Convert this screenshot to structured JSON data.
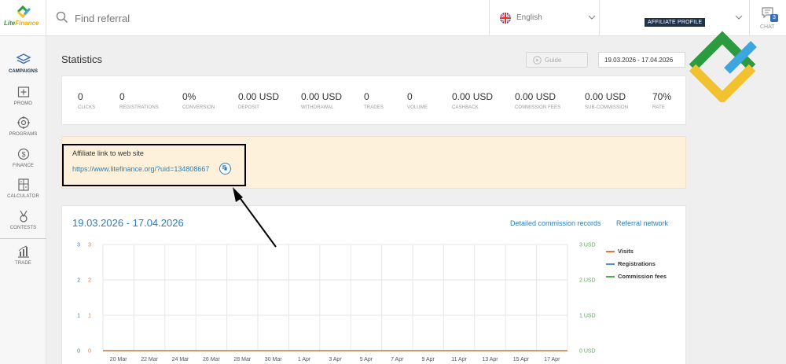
{
  "brand": {
    "name_part1": "Lite",
    "name_part2": "Finance"
  },
  "search": {
    "placeholder": "Find referral"
  },
  "language": {
    "label": "English",
    "flag_icon": "uk-flag-icon"
  },
  "profile": {
    "badge": "AFFILIATE PROFILE"
  },
  "chat": {
    "label": "CHAT",
    "count": "3"
  },
  "sidebar": {
    "items": [
      {
        "label": "CAMPAIGNS",
        "icon": "campaigns-icon",
        "active": true
      },
      {
        "label": "PROMO",
        "icon": "promo-icon"
      },
      {
        "label": "PROGRAMS",
        "icon": "programs-icon"
      },
      {
        "label": "FINANCE",
        "icon": "finance-icon"
      },
      {
        "label": "CALCULATOR",
        "icon": "calculator-icon"
      },
      {
        "label": "CONTESTS",
        "icon": "contests-icon"
      },
      {
        "label": "TRADE",
        "icon": "trade-icon"
      }
    ]
  },
  "page": {
    "title": "Statistics",
    "guide_label": "Guide",
    "date_range": "19.03.2026 - 17.04.2026"
  },
  "stats": [
    {
      "value": "0",
      "label": "CLICKS"
    },
    {
      "value": "0",
      "label": "REGISTRATIONS"
    },
    {
      "value": "0%",
      "label": "CONVERSION"
    },
    {
      "value": "0.00 USD",
      "label": "DEPOSIT"
    },
    {
      "value": "0.00 USD",
      "label": "WITHDRAWAL"
    },
    {
      "value": "0",
      "label": "TRADES"
    },
    {
      "value": "0",
      "label": "VOLUME"
    },
    {
      "value": "0.00 USD",
      "label": "CASHBACK"
    },
    {
      "value": "0.00 USD",
      "label": "COMMISSION FEES"
    },
    {
      "value": "0.00 USD",
      "label": "SUB-COMMISSION"
    },
    {
      "value": "70%",
      "label": "RATE"
    }
  ],
  "affiliate_link": {
    "title": "Affiliate link to web site",
    "url": "https://www.litefinance.org/?uid=134808667"
  },
  "chart_header": {
    "range": "19.03.2026 - 17.04.2026",
    "detailed_link": "Detailed commission records",
    "referral_link": "Referral network"
  },
  "colors": {
    "accent": "#2c7fb8",
    "visits": "#e8743b",
    "registrations": "#4a90d9",
    "commission": "#4caf50"
  },
  "chart_data": {
    "type": "line",
    "x": [
      "20 Mar",
      "22 Mar",
      "24 Mar",
      "26 Mar",
      "28 Mar",
      "30 Mar",
      "1 Apr",
      "3 Apr",
      "5 Apr",
      "7 Apr",
      "9 Apr",
      "11 Apr",
      "13 Apr",
      "15 Apr",
      "17 Apr"
    ],
    "series": [
      {
        "name": "Visits",
        "values": [
          0,
          0,
          0,
          0,
          0,
          0,
          0,
          0,
          0,
          0,
          0,
          0,
          0,
          0,
          0
        ],
        "color": "#e8743b"
      },
      {
        "name": "Registrations",
        "values": [
          0,
          0,
          0,
          0,
          0,
          0,
          0,
          0,
          0,
          0,
          0,
          0,
          0,
          0,
          0
        ],
        "color": "#4a90d9"
      },
      {
        "name": "Commission fees",
        "values": [
          0,
          0,
          0,
          0,
          0,
          0,
          0,
          0,
          0,
          0,
          0,
          0,
          0,
          0,
          0
        ],
        "color": "#4caf50"
      }
    ],
    "axes": {
      "left_outer": {
        "ticks": [
          "0",
          "1",
          "2",
          "3"
        ],
        "color": "#2c7fb8"
      },
      "left_inner": {
        "ticks": [
          "0",
          "1",
          "2",
          "3"
        ],
        "color": "#e8743b"
      },
      "right": {
        "ticks": [
          "0 USD",
          "1 USD",
          "2 USD",
          "3 USD"
        ],
        "color": "#4caf50"
      }
    },
    "ylim": [
      0,
      3
    ],
    "grid": true,
    "legend": "right"
  }
}
